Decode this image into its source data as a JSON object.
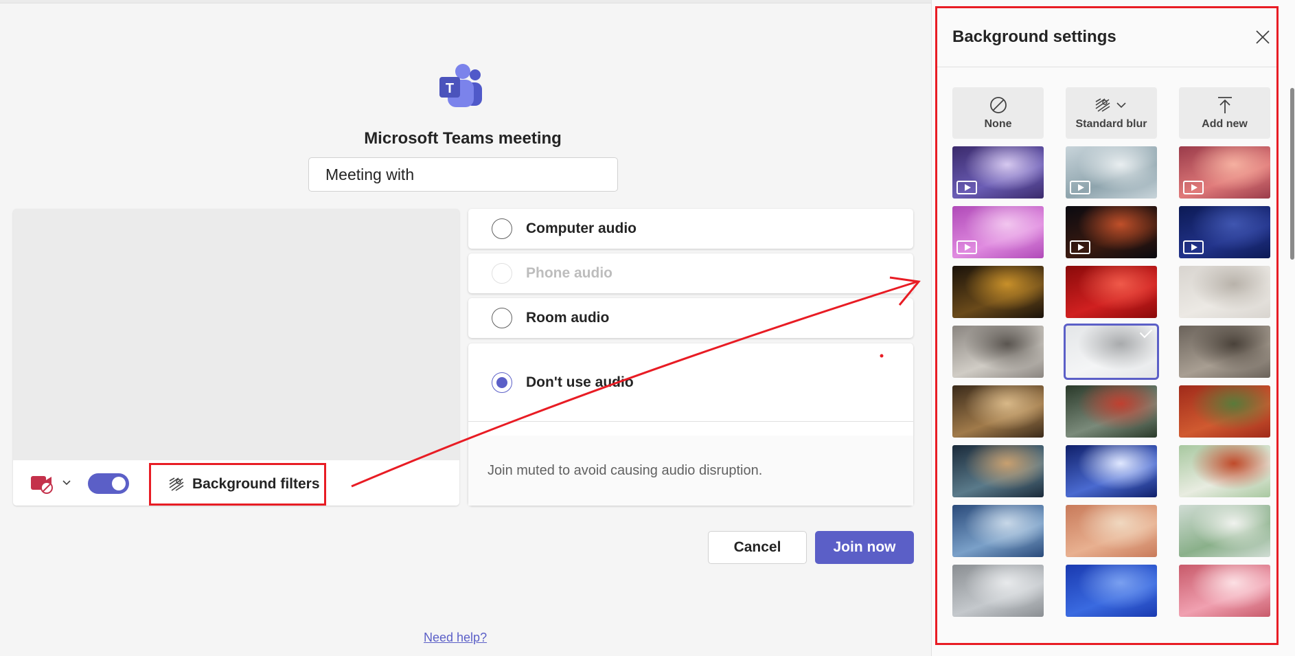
{
  "meeting": {
    "title": "Microsoft Teams meeting",
    "name_value": "Meeting with"
  },
  "video": {
    "camera_state": "off",
    "toggle_state": "on",
    "background_filters_label": "Background filters"
  },
  "audio": {
    "options": [
      {
        "label": "Computer audio",
        "selected": false,
        "enabled": true
      },
      {
        "label": "Phone audio",
        "selected": false,
        "enabled": false
      },
      {
        "label": "Room audio",
        "selected": false,
        "enabled": true
      },
      {
        "label": "Don't use audio",
        "selected": true,
        "enabled": true
      }
    ],
    "note": "Join muted to avoid causing audio disruption."
  },
  "actions": {
    "cancel_label": "Cancel",
    "join_label": "Join now"
  },
  "help": {
    "link_label": "Need help?"
  },
  "background_panel": {
    "title": "Background settings",
    "top_options": [
      {
        "label": "None",
        "icon": "none-icon"
      },
      {
        "label": "Standard blur",
        "icon": "blur-icon"
      },
      {
        "label": "Add new",
        "icon": "upload-icon"
      }
    ],
    "thumbnails": [
      {
        "name": "purple-mountains",
        "video": true,
        "colors": [
          "#3a2a6b",
          "#6b5db5",
          "#d6c9f0"
        ]
      },
      {
        "name": "snowy-trees",
        "video": true,
        "colors": [
          "#c8d4da",
          "#8ea4ad",
          "#e9eef0"
        ]
      },
      {
        "name": "pink-clouds",
        "video": true,
        "colors": [
          "#9a3b4a",
          "#e07a7a",
          "#f5b0a0"
        ]
      },
      {
        "name": "pink-flowers",
        "video": true,
        "colors": [
          "#b04ab8",
          "#e08be0",
          "#f2c6ef"
        ]
      },
      {
        "name": "dark-sparkles",
        "video": true,
        "colors": [
          "#0a0a10",
          "#3a1a10",
          "#c0502a"
        ]
      },
      {
        "name": "blue-stars",
        "video": true,
        "colors": [
          "#0c1a55",
          "#22338a",
          "#4056b0"
        ]
      },
      {
        "name": "gold-particles",
        "video": false,
        "colors": [
          "#1a120a",
          "#6a4a1a",
          "#c8902a"
        ]
      },
      {
        "name": "red-bokeh",
        "video": false,
        "colors": [
          "#8a0a0a",
          "#d02020",
          "#f05a4a"
        ]
      },
      {
        "name": "white-room",
        "video": false,
        "colors": [
          "#d8d4cf",
          "#ece9e4",
          "#b8b2aa"
        ]
      },
      {
        "name": "office-windows",
        "video": false,
        "colors": [
          "#8a8580",
          "#d0ccc5",
          "#5a5550"
        ]
      },
      {
        "name": "white-arch-room",
        "video": false,
        "colors": [
          "#e4e6e8",
          "#f4f5f6",
          "#a8aaac"
        ],
        "selected": true
      },
      {
        "name": "grey-lounge",
        "video": false,
        "colors": [
          "#6a625a",
          "#a89e92",
          "#4a423a"
        ]
      },
      {
        "name": "warm-dining",
        "video": false,
        "colors": [
          "#3a2a1a",
          "#a07a4a",
          "#d8b888"
        ]
      },
      {
        "name": "glass-pavilion",
        "video": false,
        "colors": [
          "#2a3a2a",
          "#7a8a7a",
          "#c04030"
        ]
      },
      {
        "name": "red-garden-room",
        "video": false,
        "colors": [
          "#a02a1a",
          "#d05a30",
          "#5a7a3a"
        ]
      },
      {
        "name": "space-ship",
        "video": false,
        "colors": [
          "#1a2a3a",
          "#5a7a8a",
          "#c8a070"
        ]
      },
      {
        "name": "warp-speed",
        "video": false,
        "colors": [
          "#10206a",
          "#4a6ad0",
          "#e0e8ff"
        ]
      },
      {
        "name": "green-arches",
        "video": false,
        "colors": [
          "#a8c8a0",
          "#e8ece0",
          "#c04a2a"
        ]
      },
      {
        "name": "blue-lounge",
        "video": false,
        "colors": [
          "#2a4a7a",
          "#7aa0c8",
          "#c8d8e8"
        ]
      },
      {
        "name": "desert-arch",
        "video": false,
        "colors": [
          "#c87a5a",
          "#e8b090",
          "#f0d8c0"
        ]
      },
      {
        "name": "ring-garden",
        "video": false,
        "colors": [
          "#d0dcd4",
          "#8ab08a",
          "#f0f2ee"
        ]
      },
      {
        "name": "grey-archway",
        "video": false,
        "colors": [
          "#8a8e92",
          "#c4c8cc",
          "#e8eaec"
        ]
      },
      {
        "name": "blue-arches",
        "video": false,
        "colors": [
          "#1a3ab0",
          "#3a6ae0",
          "#7aa0f0"
        ]
      },
      {
        "name": "pink-blossom-colonnade",
        "video": false,
        "colors": [
          "#c85a6a",
          "#f0a0b0",
          "#fce0e4"
        ]
      }
    ]
  },
  "colors": {
    "accent": "#5b5fc7",
    "annotation": "#e81c24"
  }
}
